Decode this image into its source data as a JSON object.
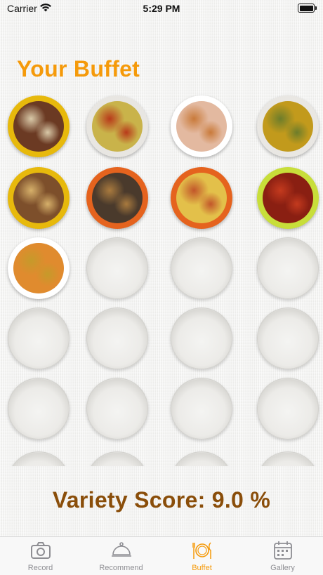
{
  "status_bar": {
    "carrier": "Carrier",
    "time": "5:29 PM"
  },
  "page": {
    "title": "Your Buffet"
  },
  "plates": [
    {
      "state": "filled",
      "rim": "#e7b90c",
      "food": "#6b3a23",
      "accent": "#d9c9a8",
      "dish": "meat-stew"
    },
    {
      "state": "filled",
      "rim": "#e8e6e2",
      "food": "#c9b34a",
      "accent": "#b83a1a",
      "dish": "fried-rice"
    },
    {
      "state": "filled",
      "rim": "#ffffff",
      "food": "#e3b9a0",
      "accent": "#c97a3a",
      "dish": "noodle-salad"
    },
    {
      "state": "filled",
      "rim": "#e9e7e3",
      "food": "#c29a1c",
      "accent": "#6d7d2a",
      "dish": "curry-rice"
    },
    {
      "state": "filled",
      "rim": "#e7b90c",
      "food": "#7d4f2b",
      "accent": "#d6b06a",
      "dish": "braised-meat"
    },
    {
      "state": "filled",
      "rim": "#e5631e",
      "food": "#4a3a2c",
      "accent": "#a97a3e",
      "dish": "bibimbap"
    },
    {
      "state": "filled",
      "rim": "#e5631e",
      "food": "#e3c04a",
      "accent": "#c2562a",
      "dish": "spaghetti"
    },
    {
      "state": "filled",
      "rim": "#c8de3a",
      "food": "#8a1f12",
      "accent": "#c43a1e",
      "dish": "spicy-stir-fry"
    },
    {
      "state": "filled",
      "rim": "#ffffff",
      "food": "#e08b2e",
      "accent": "#c69a2a",
      "dish": "breakfast-plate"
    },
    {
      "state": "empty"
    },
    {
      "state": "empty"
    },
    {
      "state": "empty"
    },
    {
      "state": "empty"
    },
    {
      "state": "empty"
    },
    {
      "state": "empty"
    },
    {
      "state": "empty"
    },
    {
      "state": "empty"
    },
    {
      "state": "empty"
    },
    {
      "state": "empty"
    },
    {
      "state": "empty"
    },
    {
      "state": "empty"
    },
    {
      "state": "empty"
    },
    {
      "state": "empty"
    },
    {
      "state": "empty"
    }
  ],
  "variety_score": "Variety Score: 9.0 %",
  "tabs": [
    {
      "label": "Record",
      "icon": "camera-icon",
      "active": false
    },
    {
      "label": "Recommend",
      "icon": "cloche-icon",
      "active": false
    },
    {
      "label": "Buffet",
      "icon": "fork-plate-knife-icon",
      "active": true
    },
    {
      "label": "Gallery",
      "icon": "calendar-icon",
      "active": false
    }
  ],
  "colors": {
    "accent": "#f59a0a",
    "score": "#8a4e0a",
    "tab_inactive": "#8e8e93"
  }
}
